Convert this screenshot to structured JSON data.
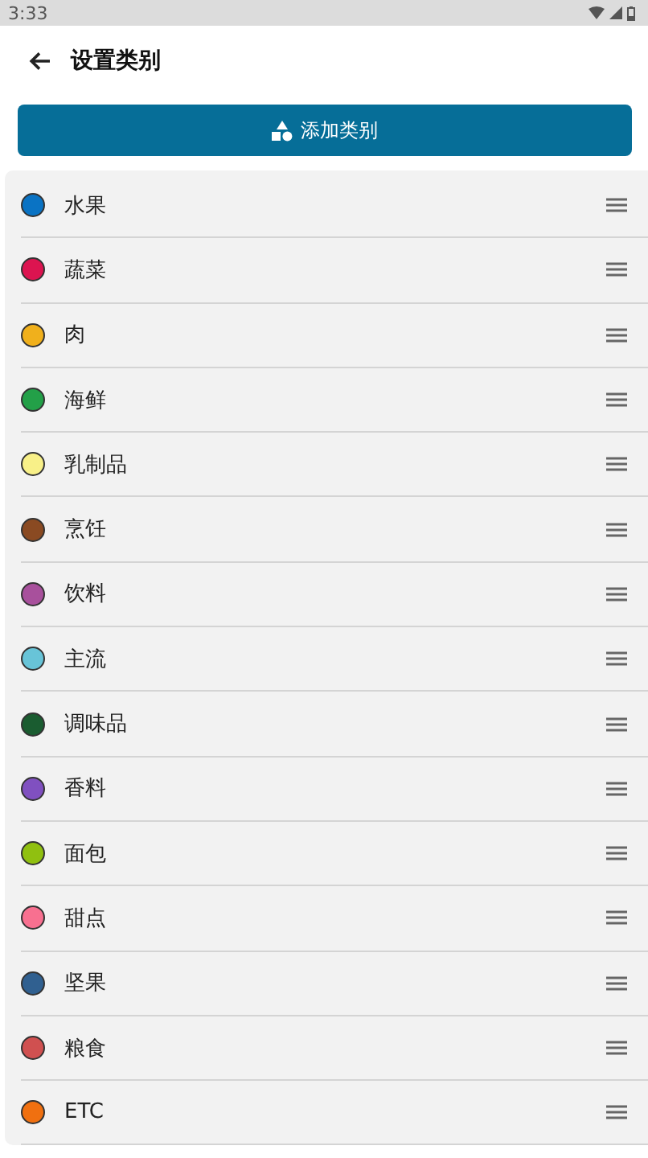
{
  "status_bar": {
    "time": "3:33"
  },
  "app_bar": {
    "title": "设置类别"
  },
  "add_button": {
    "label": "添加类别"
  },
  "categories": [
    {
      "name": "水果",
      "color": "#0a73c4"
    },
    {
      "name": "蔬菜",
      "color": "#dc1450"
    },
    {
      "name": "肉",
      "color": "#f0b01c"
    },
    {
      "name": "海鲜",
      "color": "#23a048"
    },
    {
      "name": "乳制品",
      "color": "#f8f088"
    },
    {
      "name": "烹饪",
      "color": "#8a4a22"
    },
    {
      "name": "饮料",
      "color": "#a8509c"
    },
    {
      "name": "主流",
      "color": "#68c4d8"
    },
    {
      "name": "调味品",
      "color": "#1a5c30"
    },
    {
      "name": "香料",
      "color": "#8050c0"
    },
    {
      "name": "面包",
      "color": "#90c010"
    },
    {
      "name": "甜点",
      "color": "#f87090"
    },
    {
      "name": "坚果",
      "color": "#306090"
    },
    {
      "name": "粮食",
      "color": "#d05050"
    },
    {
      "name": "ETC",
      "color": "#f07010"
    }
  ]
}
